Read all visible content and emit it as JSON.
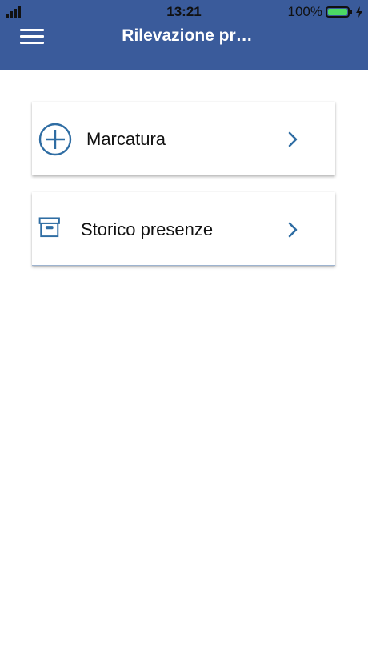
{
  "status_bar": {
    "time": "13:21",
    "battery_percent": "100%",
    "battery_level": 1.0,
    "charging": true
  },
  "header": {
    "title": "Rilevazione pr…",
    "menu_icon": "hamburger-menu-icon",
    "background_color": "#3a5b9b"
  },
  "menu": {
    "items": [
      {
        "label": "Marcatura",
        "icon": "plus-circle-icon"
      },
      {
        "label": "Storico presenze",
        "icon": "archive-box-icon"
      }
    ]
  },
  "colors": {
    "accent": "#2f6da3",
    "header": "#3a5b9b",
    "battery": "#4cd964"
  }
}
